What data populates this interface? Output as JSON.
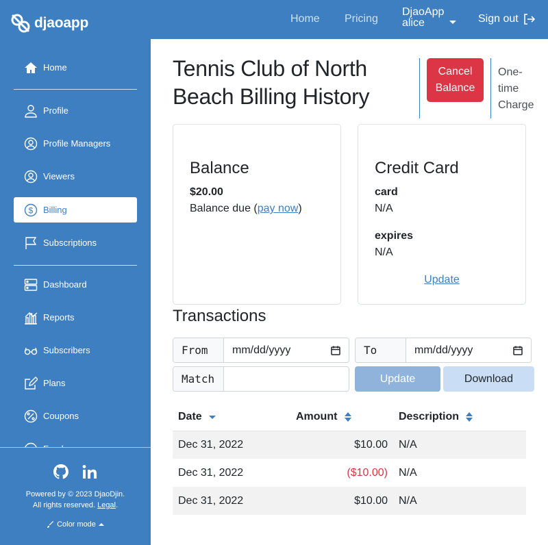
{
  "topbar": {
    "logo_text": "djaoapp",
    "nav": {
      "home": "Home",
      "pricing": "Pricing"
    },
    "user": {
      "app": "DjaoApp",
      "name": "alice"
    },
    "signout": "Sign out"
  },
  "sidebar": {
    "items": [
      {
        "label": "Home",
        "icon": "house-icon"
      },
      {
        "label": "Profile",
        "icon": "person-icon"
      },
      {
        "label": "Profile Managers",
        "icon": "person-circle-icon"
      },
      {
        "label": "Viewers",
        "icon": "person-circle-icon"
      },
      {
        "label": "Billing",
        "icon": "dollar-circle-icon",
        "active": true
      },
      {
        "label": "Subscriptions",
        "icon": "flag-icon"
      },
      {
        "label": "Dashboard",
        "icon": "server-icon"
      },
      {
        "label": "Reports",
        "icon": "bar-chart-icon"
      },
      {
        "label": "Subscribers",
        "icon": "glasses-icon"
      },
      {
        "label": "Plans",
        "icon": "pencil-square-icon"
      },
      {
        "label": "Coupons",
        "icon": "percent-circle-icon"
      },
      {
        "label": "Funds",
        "icon": "coin-icon"
      }
    ],
    "footer": {
      "powered": "Powered by © 2023 DjaoDjin.",
      "rights": "All rights reserved.",
      "legal": "Legal",
      "period": ".",
      "color_mode": "Color mode"
    }
  },
  "main": {
    "title": "Tennis Club of North Beach Billing History",
    "cancel_balance": "Cancel Balance",
    "one_time_charge": "One-time Charge",
    "balance_card": {
      "heading": "Balance",
      "amount": "$20.00",
      "due_prefix": "Balance due (",
      "pay_now": "pay now",
      "due_suffix": ")"
    },
    "credit_card": {
      "heading": "Credit Card",
      "card_label": "card",
      "card_value": "N/A",
      "expires_label": "expires",
      "expires_value": "N/A",
      "update": "Update"
    },
    "transactions": {
      "heading": "Transactions",
      "from_label": "From",
      "from_placeholder": "mm/dd/yyyy",
      "to_label": "To",
      "to_placeholder": "mm/dd/yyyy",
      "match_label": "Match",
      "match_value": "",
      "update_button": "Update",
      "download_button": "Download",
      "columns": [
        "Date",
        "Amount",
        "Description"
      ],
      "rows": [
        {
          "date": "Dec 31, 2022",
          "amount": "$10.00",
          "description": "N/A",
          "negative": false
        },
        {
          "date": "Dec 31, 2022",
          "amount": "($10.00)",
          "description": "N/A",
          "negative": true
        },
        {
          "date": "Dec 31, 2022",
          "amount": "$10.00",
          "description": "N/A",
          "negative": false
        }
      ]
    }
  },
  "colors": {
    "brand": "#3e7fc1",
    "danger": "#dc3545",
    "update_disabled": "#8fb3da",
    "download": "#c9def5"
  }
}
